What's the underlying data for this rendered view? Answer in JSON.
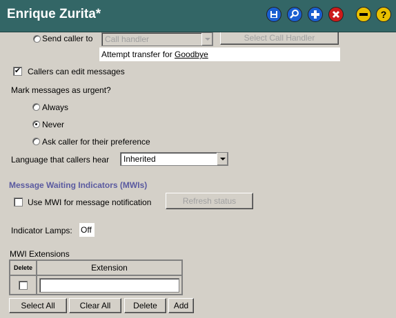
{
  "window": {
    "title": "Enrique Zurita*"
  },
  "toolbar": {
    "icons": [
      "save-icon",
      "search-icon",
      "add-icon",
      "delete-icon",
      "collapse-icon",
      "help-icon"
    ],
    "colors": {
      "bar": "#336666",
      "blue": "#1a5fd0",
      "red": "#cc1a1a",
      "yellow": "#e8c000"
    }
  },
  "transfer": {
    "send_caller_label": "Send caller to",
    "handler_select_value": "Call handler",
    "select_handler_button": "Select Call Handler",
    "attempt_prefix": "Attempt transfer for ",
    "attempt_link": "Goodbye"
  },
  "edit_messages": {
    "label": "Callers can edit messages",
    "checked": "✔"
  },
  "urgent": {
    "question": "Mark messages as urgent?",
    "options": [
      "Always",
      "Never",
      "Ask caller for their preference"
    ],
    "selected": "Never"
  },
  "language": {
    "label": "Language that callers hear",
    "value": "Inherited"
  },
  "mwi": {
    "section_title": "Message Waiting Indicators (MWIs)",
    "use_mwi_label": "Use MWI for message notification",
    "refresh_button": "Refresh status",
    "lamps_label": "Indicator Lamps:",
    "lamps_value": "Off",
    "extensions_title": "MWI Extensions",
    "table": {
      "col_delete": "Delete",
      "col_extension": "Extension",
      "row_value": ""
    },
    "buttons": {
      "select_all": "Select All",
      "clear_all": "Clear All",
      "delete": "Delete",
      "add": "Add"
    }
  }
}
